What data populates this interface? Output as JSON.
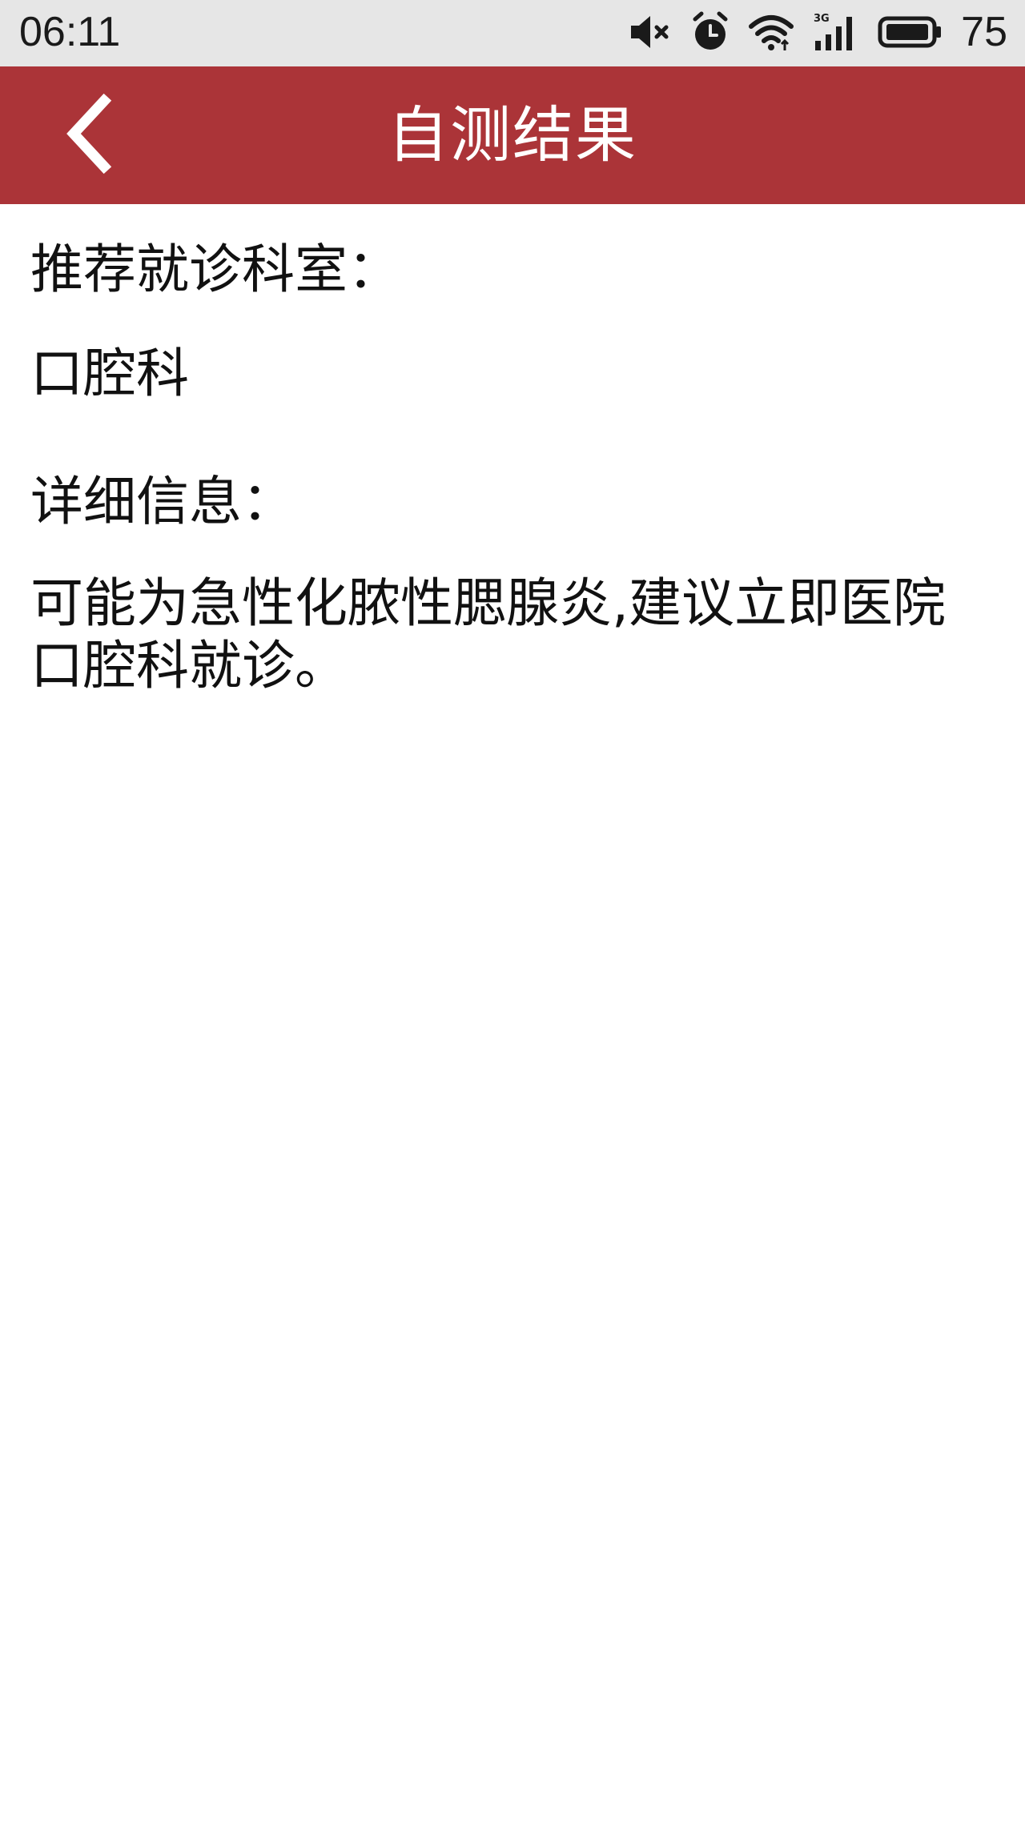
{
  "status_bar": {
    "time": "06:11",
    "network": "3G",
    "battery": "75",
    "icons": [
      "mute-icon",
      "alarm-icon",
      "wifi-icon",
      "signal-3g-icon",
      "battery-icon"
    ]
  },
  "app_bar": {
    "title": "自测结果",
    "background": "#ab3438",
    "back_icon": "chevron-left-icon"
  },
  "result": {
    "recommend_label": "推荐就诊科室：",
    "department": "口腔科",
    "detail_label": "详细信息：",
    "detail_text": "可能为急性化脓性腮腺炎,建议立即医院口腔科就诊。"
  }
}
